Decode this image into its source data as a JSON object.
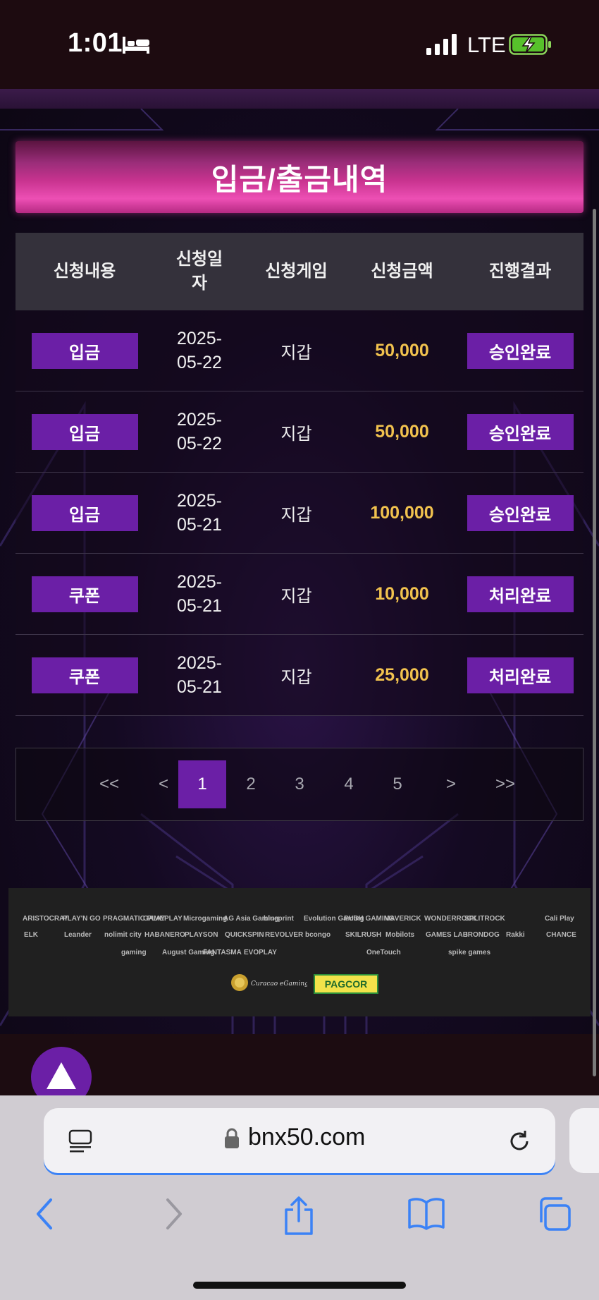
{
  "status_bar": {
    "time": "1:01",
    "network": "LTE"
  },
  "page": {
    "title": "입금/출금내역",
    "table": {
      "headers": [
        "신청내용",
        "신청일\n자",
        "신청게임",
        "신청금액",
        "진행결과"
      ],
      "rows": [
        {
          "type": "입금",
          "date_line1": "2025-",
          "date_line2": "05-22",
          "game": "지갑",
          "amount": "50,000",
          "status": "승인완료"
        },
        {
          "type": "입금",
          "date_line1": "2025-",
          "date_line2": "05-22",
          "game": "지갑",
          "amount": "50,000",
          "status": "승인완료"
        },
        {
          "type": "입금",
          "date_line1": "2025-",
          "date_line2": "05-21",
          "game": "지갑",
          "amount": "100,000",
          "status": "승인완료"
        },
        {
          "type": "쿠폰",
          "date_line1": "2025-",
          "date_line2": "05-21",
          "game": "지갑",
          "amount": "10,000",
          "status": "처리완료"
        },
        {
          "type": "쿠폰",
          "date_line1": "2025-",
          "date_line2": "05-21",
          "game": "지갑",
          "amount": "25,000",
          "status": "처리완료"
        }
      ]
    },
    "pagination": {
      "first": "<<",
      "prev": "<",
      "pages": [
        "1",
        "2",
        "3",
        "4",
        "5"
      ],
      "current": "1",
      "next": ">",
      "last": ">>"
    },
    "providers": {
      "row1": [
        "ARISTOCRAT",
        "PLAY'N GO",
        "PRAGMATIC PLAY",
        "GAMEPLAY",
        "Microgaming",
        "AG Asia Gaming",
        "blueprint",
        "Evolution Gaming",
        "PUSH GAMING",
        "MAVERICK",
        "WONDERROCK",
        "SPLITROCK",
        "",
        "Cali Play"
      ],
      "row2": [
        "ELK",
        "Leander",
        "nolimit city",
        "HABANERO",
        "PLAYSON",
        "QUICKSPIN",
        "REVOLVER",
        "bcongo",
        "SKILRUSH",
        "Mobilots",
        "GAMES LAB",
        "IRONDOG",
        "Rakki",
        "CHANCE"
      ],
      "row3": [
        "gaming",
        "August Gaming",
        "FANTASMA",
        "EVOPLAY",
        "",
        "",
        "OneTouch",
        "",
        "spike games"
      ],
      "licenses": [
        "Curacao eGaming",
        "PAGCOR"
      ]
    }
  },
  "browser": {
    "url": "bnx50.com"
  },
  "colors": {
    "accent": "#6b1fa6",
    "amount": "#f1c24e",
    "banner": "#c8338f",
    "url_underline": "#3b82f6"
  }
}
